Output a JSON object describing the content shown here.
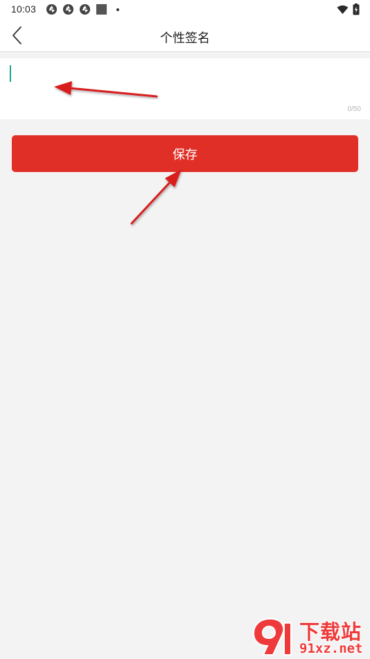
{
  "status_bar": {
    "time": "10:03",
    "icons_left": [
      "aperture-icon",
      "aperture-icon",
      "aperture-icon",
      "square-icon",
      "dot-icon"
    ],
    "icons_right": [
      "wifi-icon",
      "battery-charging-icon"
    ]
  },
  "header": {
    "back_icon": "chevron-left-icon",
    "title": "个性签名"
  },
  "signature": {
    "value": "",
    "placeholder": "",
    "counter": "0/50"
  },
  "actions": {
    "save_label": "保存"
  },
  "colors": {
    "accent": "#e02f27",
    "cursor": "#1aa58d",
    "background": "#f3f3f3",
    "annotation_arrow": "#d91c1c"
  },
  "watermark": {
    "name": "下载站",
    "url": "91xz.net"
  }
}
